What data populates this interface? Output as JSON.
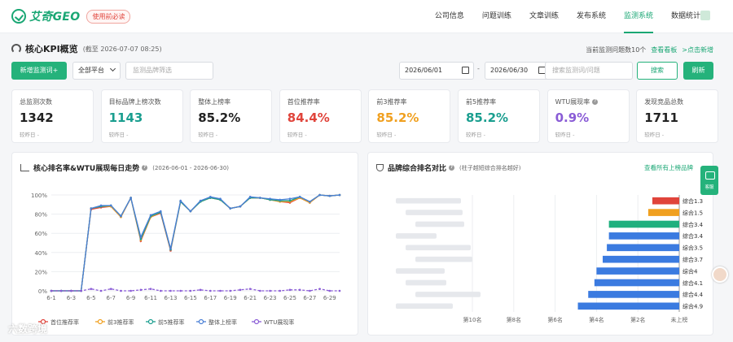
{
  "topbar": {
    "logo_text": "艾奇GEO",
    "badge": "使用前必读",
    "nav": [
      {
        "label": "公司信息",
        "active": false
      },
      {
        "label": "问题训练",
        "active": false
      },
      {
        "label": "文章训练",
        "active": false
      },
      {
        "label": "发布系统",
        "active": false
      },
      {
        "label": "监测系统",
        "active": true
      },
      {
        "label": "数据统计",
        "active": false
      }
    ]
  },
  "kpi_header": {
    "title": "核心KPI概览",
    "as_of": "(截至 2026-07-07 08:25)",
    "monitor_count": "当前监测问题数10个",
    "view_link": "查看看板",
    "add_link": ">点击新增"
  },
  "filters": {
    "add_button": "新增监测词+",
    "platform": "全部平台",
    "brand_placeholder": "监测品牌筛选",
    "start_date": "2026/06/01",
    "end_date": "2026/06/30",
    "date_sep": "-",
    "search_placeholder": "搜索监测词/问题",
    "search_button": "搜索",
    "refresh_button": "刷新"
  },
  "cards": [
    {
      "label": "总监测次数",
      "value": "1342",
      "foot": "较昨日 -",
      "color": "#222222",
      "info": false
    },
    {
      "label": "目标品牌上榜次数",
      "value": "1143",
      "foot": "较昨日 -",
      "color": "#1a9e8f",
      "info": false
    },
    {
      "label": "整体上榜率",
      "value": "85.2%",
      "foot": "较昨日 -",
      "color": "#222222",
      "info": false
    },
    {
      "label": "首位推荐率",
      "value": "84.4%",
      "foot": "较昨日 -",
      "color": "#e0443b",
      "info": false
    },
    {
      "label": "前3推荐率",
      "value": "85.2%",
      "foot": "较昨日 -",
      "color": "#f0a020",
      "info": false
    },
    {
      "label": "前5推荐率",
      "value": "85.2%",
      "foot": "较昨日 -",
      "color": "#1a9e8f",
      "info": false
    },
    {
      "label": "WTU展现率",
      "value": "0.9%",
      "foot": "较昨日 -",
      "color": "#8a5cd6",
      "info": true
    },
    {
      "label": "发现竞品总数",
      "value": "1711",
      "foot": "较昨日 -",
      "color": "#222222",
      "info": false
    }
  ],
  "colors": {
    "accent": "#25b27b",
    "first": "#e0443b",
    "top3": "#f0a020",
    "top5": "#1a9e8f",
    "overall": "#4a7fd6",
    "wtu": "#8a5cd6"
  },
  "trend_panel": {
    "title": "核心排名率&WTU展现每日走势",
    "range": "(2026-06-01 - 2026-06-30)"
  },
  "rank_panel": {
    "title": "品牌综合排名对比",
    "hint": "(柱子越短综合排名越好)",
    "link": "查看所有上榜品牌"
  },
  "float_button": "客服",
  "watermark": "六数跨境",
  "chart_data": [
    {
      "type": "line",
      "title": "核心排名率&WTU展现每日走势",
      "x": [
        "6-1",
        "6-2",
        "6-3",
        "6-4",
        "6-5",
        "6-6",
        "6-7",
        "6-8",
        "6-9",
        "6-10",
        "6-11",
        "6-12",
        "6-13",
        "6-14",
        "6-15",
        "6-16",
        "6-17",
        "6-18",
        "6-19",
        "6-20",
        "6-21",
        "6-22",
        "6-23",
        "6-24",
        "6-25",
        "6-26",
        "6-27",
        "6-28",
        "6-29",
        "6-30"
      ],
      "x_ticks": [
        "6-1",
        "6-3",
        "6-5",
        "6-7",
        "6-9",
        "6-11",
        "6-13",
        "6-15",
        "6-17",
        "6-19",
        "6-21",
        "6-23",
        "6-25",
        "6-27",
        "6-29"
      ],
      "y_ticks": [
        "0%",
        "20%",
        "40%",
        "60%",
        "80%",
        "100%"
      ],
      "ylim": [
        0,
        100
      ],
      "series": [
        {
          "name": "首位推荐率",
          "color": "#e0443b",
          "values": [
            0,
            0,
            0,
            0,
            85,
            87,
            88,
            77,
            97,
            52,
            77,
            81,
            42,
            93,
            83,
            93,
            97,
            95,
            86,
            88,
            97,
            97,
            95,
            93,
            92,
            97,
            92,
            100,
            99,
            100
          ]
        },
        {
          "name": "前3推荐率",
          "color": "#f0a020",
          "values": [
            0,
            0,
            0,
            0,
            86,
            88,
            88,
            77,
            97,
            53,
            77,
            82,
            43,
            93,
            83,
            93,
            97,
            95,
            86,
            88,
            97,
            97,
            95,
            93,
            93,
            97,
            92,
            100,
            99,
            100
          ]
        },
        {
          "name": "前5推荐率",
          "color": "#1a9e8f",
          "values": [
            0,
            0,
            0,
            0,
            86,
            88,
            89,
            78,
            97,
            54,
            78,
            82,
            43,
            93,
            83,
            93,
            97,
            95,
            86,
            88,
            97,
            97,
            95,
            94,
            94,
            98,
            93,
            100,
            99,
            100
          ]
        },
        {
          "name": "整体上榜率",
          "color": "#4a7fd6",
          "values": [
            0,
            0,
            0,
            0,
            86,
            89,
            89,
            78,
            97,
            56,
            79,
            83,
            44,
            94,
            83,
            94,
            98,
            96,
            86,
            88,
            98,
            97,
            96,
            95,
            96,
            98,
            93,
            100,
            99,
            100
          ]
        },
        {
          "name": "WTU展现率",
          "color": "#8a5cd6",
          "values": [
            0,
            0,
            0,
            0,
            2,
            0,
            2,
            0,
            0,
            1,
            2,
            0,
            0,
            0,
            0,
            1,
            0,
            0,
            0,
            1,
            2,
            0,
            0,
            0,
            1,
            1,
            0,
            2,
            0,
            0
          ]
        }
      ],
      "legend_position": "bottom"
    },
    {
      "type": "bar",
      "orientation": "horizontal",
      "title": "品牌综合排名对比",
      "categories": [
        "",
        "",
        "",
        "",
        "",
        "",
        "",
        "",
        "",
        ""
      ],
      "values": [
        1.3,
        1.5,
        3.4,
        3.4,
        3.5,
        3.7,
        4,
        4.1,
        4.4,
        4.9
      ],
      "labels": [
        "综合1.3",
        "综合1.5",
        "综合3.4",
        "综合3.4",
        "综合3.5",
        "综合3.7",
        "综合4",
        "综合4.1",
        "综合4.4",
        "综合4.9"
      ],
      "colors": [
        "#e0443b",
        "#f0a020",
        "#1fb07e",
        "#3b7be0",
        "#3b7be0",
        "#3b7be0",
        "#3b7be0",
        "#3b7be0",
        "#3b7be0",
        "#3b7be0"
      ],
      "x_ticks": [
        "第10名",
        "第8名",
        "第6名",
        "第4名",
        "第2名",
        "未上榜"
      ],
      "xlim": [
        0,
        10
      ],
      "reversed": true
    }
  ]
}
